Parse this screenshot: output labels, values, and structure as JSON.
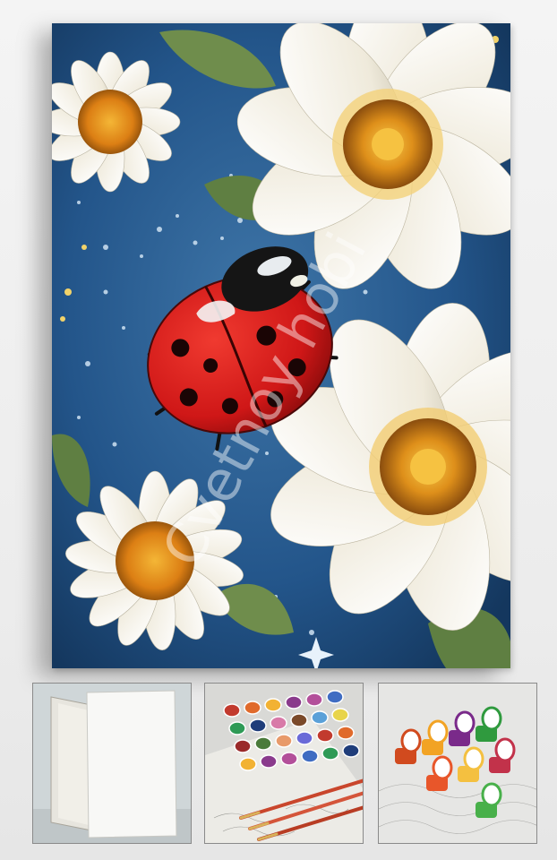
{
  "watermark": "Cvetnoy hobi",
  "colors": {
    "background_blue": "#1d4a78",
    "ladybug_red": "#d81e1e",
    "petal_white": "#f2efe6",
    "flower_center": "#d98a16",
    "leaf_green": "#6d8a4a"
  },
  "icons": {
    "main": "ladybug-on-daisies-painting",
    "thumb_1": "blank-canvas",
    "thumb_2": "paint-pots-and-brushes",
    "thumb_3": "open-paint-pots"
  }
}
